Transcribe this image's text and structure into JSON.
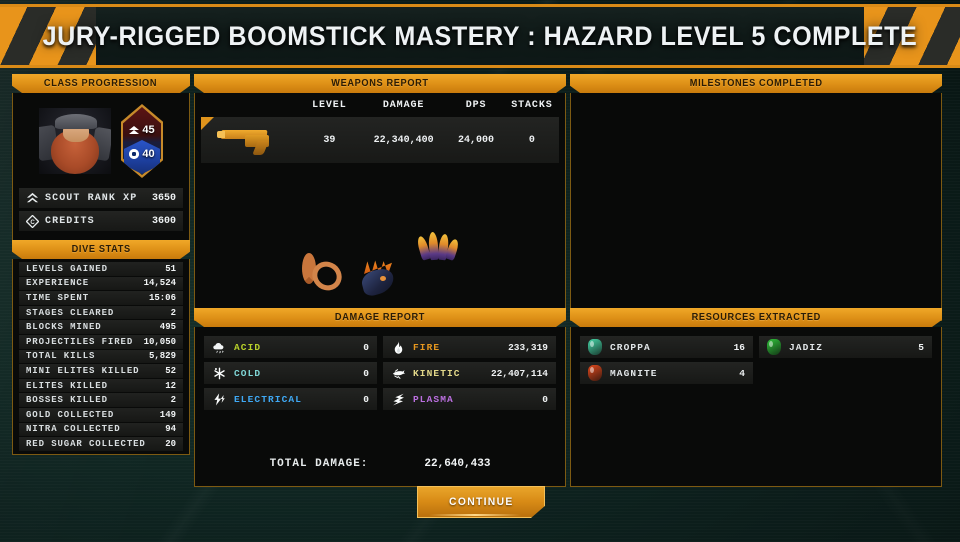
{
  "banner": {
    "title": "JURY-RIGGED BOOMSTICK MASTERY : HAZARD LEVEL 5 COMPLETE"
  },
  "class_panel": {
    "title": "CLASS PROGRESSION",
    "rank_primary": "45",
    "rank_secondary": "40",
    "rows": [
      {
        "icon": "chevron-rank-icon",
        "label": "SCOUT RANK XP",
        "value": "3650"
      },
      {
        "icon": "credits-icon",
        "label": "CREDITS",
        "value": "3600"
      }
    ]
  },
  "dive_stats": {
    "title": "DIVE STATS",
    "rows": [
      {
        "label": "LEVELS GAINED",
        "value": "51"
      },
      {
        "label": "EXPERIENCE",
        "value": "14,524"
      },
      {
        "label": "TIME SPENT",
        "value": "15:06"
      },
      {
        "label": "STAGES CLEARED",
        "value": "2"
      },
      {
        "label": "BLOCKS MINED",
        "value": "495"
      },
      {
        "label": "PROJECTILES FIRED",
        "value": "10,050"
      },
      {
        "label": "TOTAL KILLS",
        "value": "5,829"
      },
      {
        "label": "MINI ELITES KILLED",
        "value": "52"
      },
      {
        "label": "ELITES KILLED",
        "value": "12"
      },
      {
        "label": "BOSSES KILLED",
        "value": "2"
      },
      {
        "label": "GOLD COLLECTED",
        "value": "149"
      },
      {
        "label": "NITRA COLLECTED",
        "value": "94"
      },
      {
        "label": "RED SUGAR COLLECTED",
        "value": "20"
      }
    ]
  },
  "weapons_report": {
    "title": "WEAPONS REPORT",
    "columns": [
      "LEVEL",
      "DAMAGE",
      "DPS",
      "STACKS"
    ],
    "rows": [
      {
        "weapon_icon": "shotgun-icon",
        "level": "39",
        "damage": "22,340,400",
        "dps": "24,000",
        "stacks": "0"
      }
    ],
    "artifacts": [
      "pretzel-artifact-icon",
      "creature-head-artifact-icon",
      "claws-artifact-icon"
    ]
  },
  "milestones": {
    "title": "MILESTONES COMPLETED",
    "items": []
  },
  "damage_report": {
    "title": "DAMAGE REPORT",
    "types": [
      {
        "icon": "acid-icon",
        "name": "ACID",
        "value": "0",
        "color": "#b8d12a"
      },
      {
        "icon": "fire-icon",
        "name": "FIRE",
        "value": "233,319",
        "color": "#e8981f"
      },
      {
        "icon": "cold-icon",
        "name": "COLD",
        "value": "0",
        "color": "#7fd6d6"
      },
      {
        "icon": "kinetic-icon",
        "name": "KINETIC",
        "value": "22,407,114",
        "color": "#e3d98a"
      },
      {
        "icon": "electrical-icon",
        "name": "ELECTRICAL",
        "value": "0",
        "color": "#3fa9f5"
      },
      {
        "icon": "plasma-icon",
        "name": "PLASMA",
        "value": "0",
        "color": "#bb6fe0"
      }
    ],
    "total_label": "TOTAL DAMAGE:",
    "total_value": "22,640,433"
  },
  "resources": {
    "title": "RESOURCES EXTRACTED",
    "items": [
      {
        "icon": "croppa-gem-icon",
        "name": "CROPPA",
        "value": "16",
        "color": "#46d6a8"
      },
      {
        "icon": "jadiz-gem-icon",
        "name": "JADIZ",
        "value": "5",
        "color": "#2fc33a"
      },
      {
        "icon": "magnite-gem-icon",
        "name": "MAGNITE",
        "value": "4",
        "color": "#e2491c"
      }
    ]
  },
  "continue": {
    "label": "CONTINUE"
  }
}
